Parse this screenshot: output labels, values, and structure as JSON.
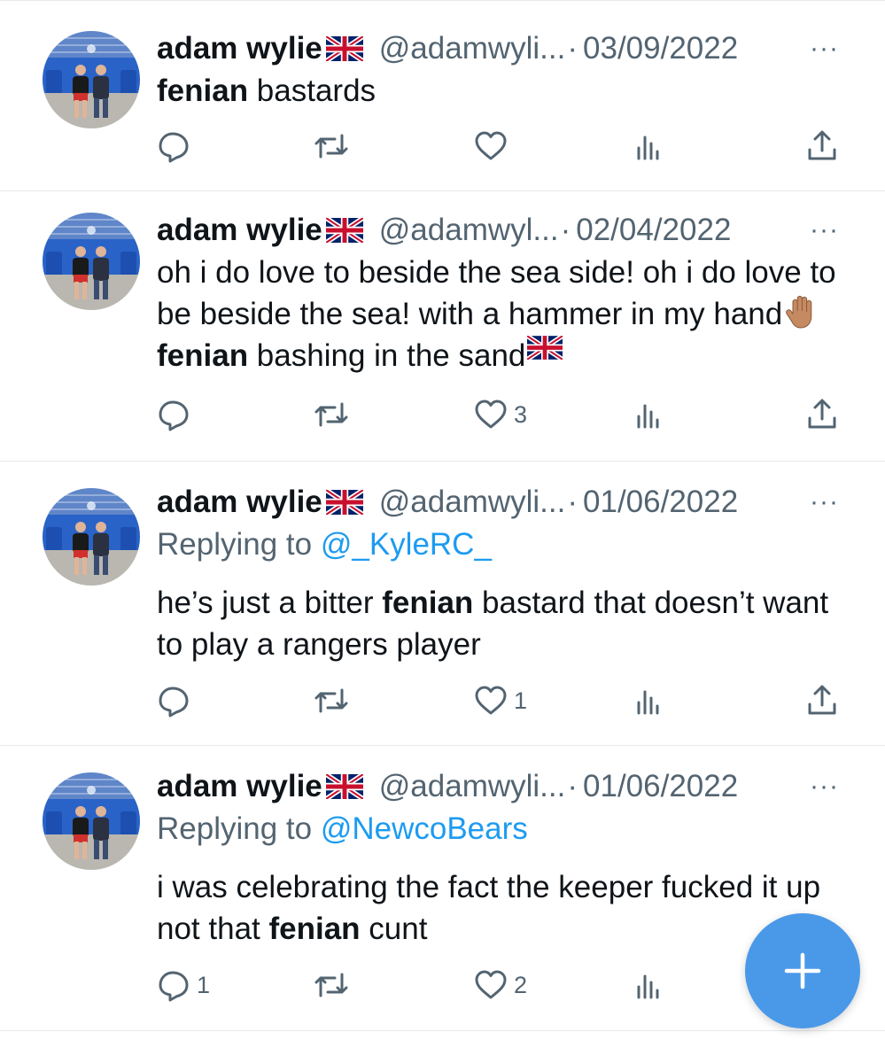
{
  "tweets": [
    {
      "name": "adam wylie",
      "handle": "@adamwyli...",
      "dot": "·",
      "date": "03/09/2022",
      "more": "···",
      "reply_label": "",
      "reply_mention": "",
      "text": [
        {
          "t": "fenian",
          "bold": true
        },
        {
          "t": " bastards",
          "bold": false
        }
      ],
      "counts": {
        "reply": "",
        "retweet": "",
        "like": ""
      }
    },
    {
      "name": "adam wylie",
      "handle": "@adamwyl...",
      "dot": "·",
      "date": "02/04/2022",
      "more": "···",
      "reply_label": "",
      "reply_mention": "",
      "text": [
        {
          "t": "oh i do love to beside the sea side! oh i do love to be beside the sea! with a hammer in my hand",
          "bold": false
        },
        {
          "emoji": "raised-hand-emoji"
        },
        {
          "t": " ",
          "bold": false
        },
        {
          "t": "fenian",
          "bold": true
        },
        {
          "t": " bashing in the sand",
          "bold": false
        },
        {
          "emoji": "uk-flag-emoji"
        }
      ],
      "counts": {
        "reply": "",
        "retweet": "",
        "like": "3"
      }
    },
    {
      "name": "adam wylie",
      "handle": "@adamwyli...",
      "dot": "·",
      "date": "01/06/2022",
      "more": "···",
      "reply_label": "Replying to ",
      "reply_mention": "@_KyleRC_",
      "text": [
        {
          "t": "he’s just a bitter ",
          "bold": false
        },
        {
          "t": "fenian",
          "bold": true
        },
        {
          "t": " bastard that doesn’t want to play a rangers player",
          "bold": false
        }
      ],
      "counts": {
        "reply": "",
        "retweet": "",
        "like": "1"
      }
    },
    {
      "name": "adam wylie",
      "handle": "@adamwyli...",
      "dot": "·",
      "date": "01/06/2022",
      "more": "···",
      "reply_label": "Replying to ",
      "reply_mention": "@NewcoBears",
      "text": [
        {
          "t": "i was celebrating the fact the keeper fucked it up not that ",
          "bold": false
        },
        {
          "t": "fenian",
          "bold": true
        },
        {
          "t": " cunt",
          "bold": false
        }
      ],
      "counts": {
        "reply": "1",
        "retweet": "",
        "like": "2"
      }
    }
  ],
  "icons": {
    "reply": "reply-icon",
    "retweet": "retweet-icon",
    "like": "heart-icon",
    "views": "views-icon",
    "share": "share-icon",
    "compose": "plus-icon",
    "flag": "uk-flag-icon"
  },
  "colors": {
    "text": "#0f1419",
    "muted": "#536471",
    "link": "#1d9bf0",
    "fab": "#4a99e9",
    "divider": "#e7e9ea"
  }
}
